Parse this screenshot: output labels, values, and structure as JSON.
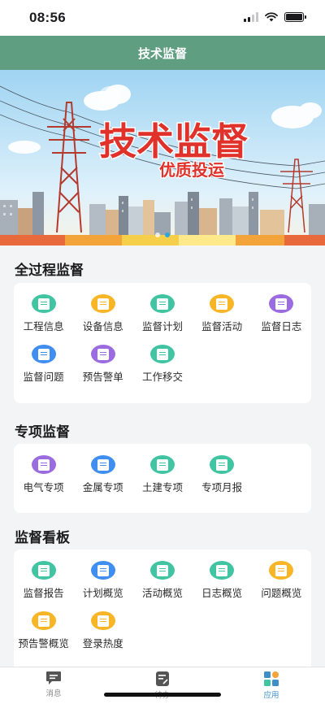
{
  "status": {
    "time": "08:56"
  },
  "header": {
    "title": "技术监督"
  },
  "banner": {
    "main_text": "技术监督",
    "sub_text": "优质投运"
  },
  "sections": [
    {
      "title": "全过程监督",
      "items": [
        {
          "label": "工程信息",
          "icon": "engineer-helmet-icon",
          "color": "#41c4a2"
        },
        {
          "label": "设备信息",
          "icon": "device-list-icon",
          "color": "#f8b526"
        },
        {
          "label": "监督计划",
          "icon": "calendar-plan-icon",
          "color": "#41c4a2"
        },
        {
          "label": "监督活动",
          "icon": "activity-board-icon",
          "color": "#f8b526"
        },
        {
          "label": "监督日志",
          "icon": "log-book-icon",
          "color": "#9b6be0"
        },
        {
          "label": "监督问题",
          "icon": "question-doc-icon",
          "color": "#3f8ef0"
        },
        {
          "label": "预告警单",
          "icon": "alert-print-icon",
          "color": "#9b6be0"
        },
        {
          "label": "工作移交",
          "icon": "handover-door-icon",
          "color": "#41c4a2"
        }
      ]
    },
    {
      "title": "专项监督",
      "items": [
        {
          "label": "电气专项",
          "icon": "electric-cabinet-icon",
          "color": "#9b6be0"
        },
        {
          "label": "金属专项",
          "icon": "metal-stack-icon",
          "color": "#3f8ef0"
        },
        {
          "label": "土建专项",
          "icon": "construction-truck-icon",
          "color": "#41c4a2"
        },
        {
          "label": "专项月报",
          "icon": "monthly-report-icon",
          "color": "#41c4a2"
        }
      ]
    },
    {
      "title": "监督看板",
      "items": [
        {
          "label": "监督报告",
          "icon": "report-helmet-icon",
          "color": "#41c4a2"
        },
        {
          "label": "计划概览",
          "icon": "plan-clipboard-icon",
          "color": "#3f8ef0"
        },
        {
          "label": "活动概览",
          "icon": "activity-door-icon",
          "color": "#41c4a2"
        },
        {
          "label": "日志概览",
          "icon": "log-overview-icon",
          "color": "#41c4a2"
        },
        {
          "label": "问题概览",
          "icon": "issue-list-icon",
          "color": "#f8b526"
        },
        {
          "label": "预告警概览",
          "icon": "alert-overview-icon",
          "color": "#f8b526"
        },
        {
          "label": "登录热度",
          "icon": "login-heat-icon",
          "color": "#f8b526"
        }
      ]
    }
  ],
  "tabs": [
    {
      "label": "消息",
      "icon": "message-icon",
      "active": false
    },
    {
      "label": "待办",
      "icon": "todo-icon",
      "active": false
    },
    {
      "label": "应用",
      "icon": "apps-grid-icon",
      "active": true
    }
  ],
  "colors": {
    "header": "#5f9e80",
    "tab_active": "#3f8fc7"
  }
}
